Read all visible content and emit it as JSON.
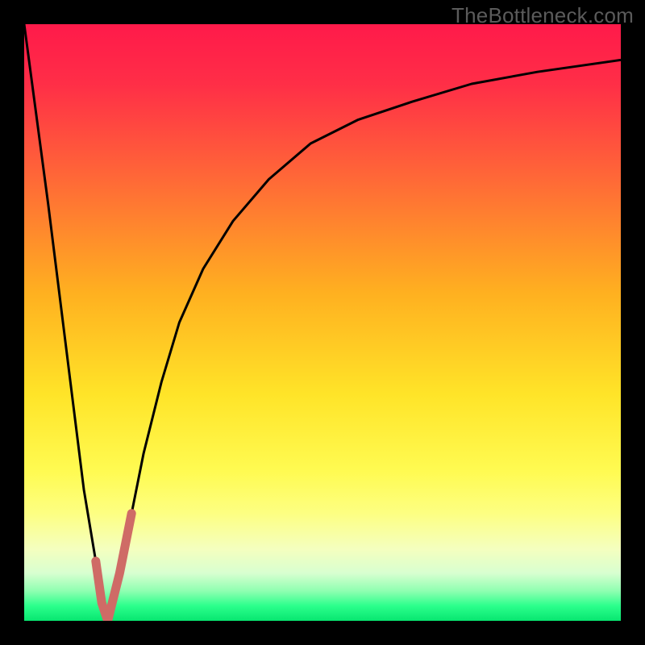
{
  "watermark": "TheBottleneck.com",
  "colors": {
    "frame": "#000000",
    "curve_primary": "#000000",
    "curve_accent": "#cf6b66",
    "gradient_stops": [
      {
        "offset": 0.0,
        "color": "#ff1a4a"
      },
      {
        "offset": 0.1,
        "color": "#ff2e47"
      },
      {
        "offset": 0.25,
        "color": "#ff6538"
      },
      {
        "offset": 0.45,
        "color": "#ffb020"
      },
      {
        "offset": 0.62,
        "color": "#ffe428"
      },
      {
        "offset": 0.75,
        "color": "#fffb52"
      },
      {
        "offset": 0.82,
        "color": "#fdff82"
      },
      {
        "offset": 0.88,
        "color": "#f4ffbf"
      },
      {
        "offset": 0.92,
        "color": "#d8ffd0"
      },
      {
        "offset": 0.95,
        "color": "#8fffb1"
      },
      {
        "offset": 0.975,
        "color": "#2bff8c"
      },
      {
        "offset": 1.0,
        "color": "#08e670"
      }
    ]
  },
  "chart_data": {
    "type": "line",
    "title": "",
    "xlabel": "",
    "ylabel": "",
    "xlim": [
      0,
      100
    ],
    "ylim": [
      0,
      100
    ],
    "grid": false,
    "series": [
      {
        "name": "bottleneck-curve",
        "x": [
          0,
          4,
          8,
          10,
          12,
          13,
          14,
          16,
          18,
          20,
          23,
          26,
          30,
          35,
          41,
          48,
          56,
          65,
          75,
          86,
          100
        ],
        "values": [
          100,
          70,
          38,
          22,
          10,
          3,
          0,
          8,
          18,
          28,
          40,
          50,
          59,
          67,
          74,
          80,
          84,
          87,
          90,
          92,
          94
        ]
      },
      {
        "name": "accent-segment",
        "x": [
          12,
          13,
          14,
          16,
          18
        ],
        "values": [
          10,
          3,
          0,
          8,
          18
        ]
      }
    ],
    "annotations": []
  }
}
